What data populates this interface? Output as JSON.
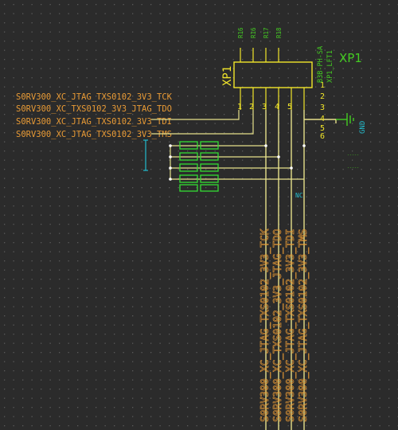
{
  "colors": {
    "background": "#2b2b2b",
    "grid_dot": "#5a5a5a",
    "wire": "#e6e08a",
    "component": "#f2e62a",
    "net_label": "#e89a35",
    "comp_green": "#44cc22",
    "resistor": "#33dd33",
    "cyan": "#22bbcc",
    "dim_text": "#c8c070"
  },
  "connector": {
    "ref": "XP1",
    "ref_big": "XP1",
    "value": "B3B-PH-SA",
    "pin_numbers": [
      "1",
      "2",
      "3",
      "4",
      "5",
      "6"
    ],
    "side_pins": [
      "1",
      "2",
      "3",
      "4",
      "5",
      "6"
    ],
    "side_pin_6": "6",
    "footprint": "XP1_LFT1"
  },
  "top_resistors": [
    "R16",
    "R16",
    "R17",
    "R18"
  ],
  "gnd_label": "GND",
  "net_labels_left": [
    "S0RV300_XC_JTAG_TXS0102_3V3_TCK",
    "S0RV300_XC_TXS0102_3V3_JTAG_TDO",
    "S0RV300_XC_JTAG_TXS0102_3V3_TDI",
    "S0RV300_XC_JTAG_TXS0102_3V3_TMS"
  ],
  "net_labels_vertical": [
    "S0RV300_XC_JTAG_TXS0102_3V3_TCK",
    "S0RV300_XC_TXS0102_3V3_JTAG_TDO",
    "S0RV300_XC_JTAG_TXS0102_3V3_TDI",
    "S0RV300_XC_JTAG_TXS0102_3V3_TMS"
  ],
  "small_cyan_label": "NC",
  "tiny_labels": [
    "-----",
    "-----"
  ]
}
